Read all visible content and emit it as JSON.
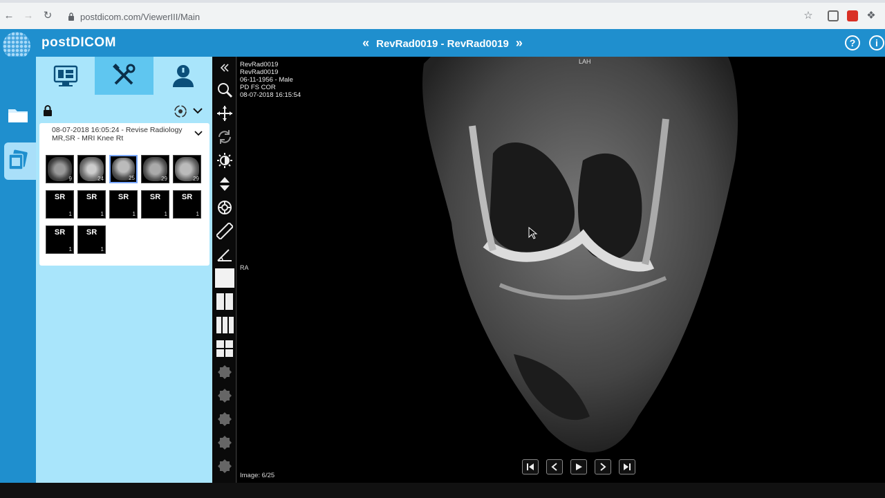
{
  "browser": {
    "url": "postdicom.com/ViewerIII/Main"
  },
  "header": {
    "logo_text": "postDICOM",
    "patient_title": "RevRad0019 - RevRad0019",
    "help_icon": "?",
    "info_icon": "i"
  },
  "panel": {
    "study": {
      "line1": "08-07-2018 16:05:24 - Revise Radiology",
      "line2": "MR,SR - MRI Knee Rt"
    },
    "thumbnails": [
      {
        "label": "",
        "count": "9",
        "type": "image"
      },
      {
        "label": "",
        "count": "24",
        "type": "image"
      },
      {
        "label": "",
        "count": "25",
        "type": "image"
      },
      {
        "label": "",
        "count": "29",
        "type": "image"
      },
      {
        "label": "",
        "count": "29",
        "type": "image"
      },
      {
        "label": "SR",
        "count": "1",
        "type": "sr"
      },
      {
        "label": "SR",
        "count": "1",
        "type": "sr"
      },
      {
        "label": "SR",
        "count": "1",
        "type": "sr"
      },
      {
        "label": "SR",
        "count": "1",
        "type": "sr"
      },
      {
        "label": "SR",
        "count": "1",
        "type": "sr"
      },
      {
        "label": "SR",
        "count": "1",
        "type": "sr"
      },
      {
        "label": "SR",
        "count": "1",
        "type": "sr"
      }
    ]
  },
  "viewport": {
    "overlay": {
      "line1": "RevRad0019",
      "line2": "RevRad0019",
      "line3": "06-11-1956 - Male",
      "line4": "PD FS COR",
      "line5": "08-07-2018 16:15:54"
    },
    "orientation_top": "LAH",
    "orientation_left": "RA",
    "image_counter": "Image: 6/25"
  },
  "colors": {
    "brand_blue": "#1f8fce",
    "panel_bg": "#a9e5fb",
    "tab_active": "#5fc6f0"
  }
}
